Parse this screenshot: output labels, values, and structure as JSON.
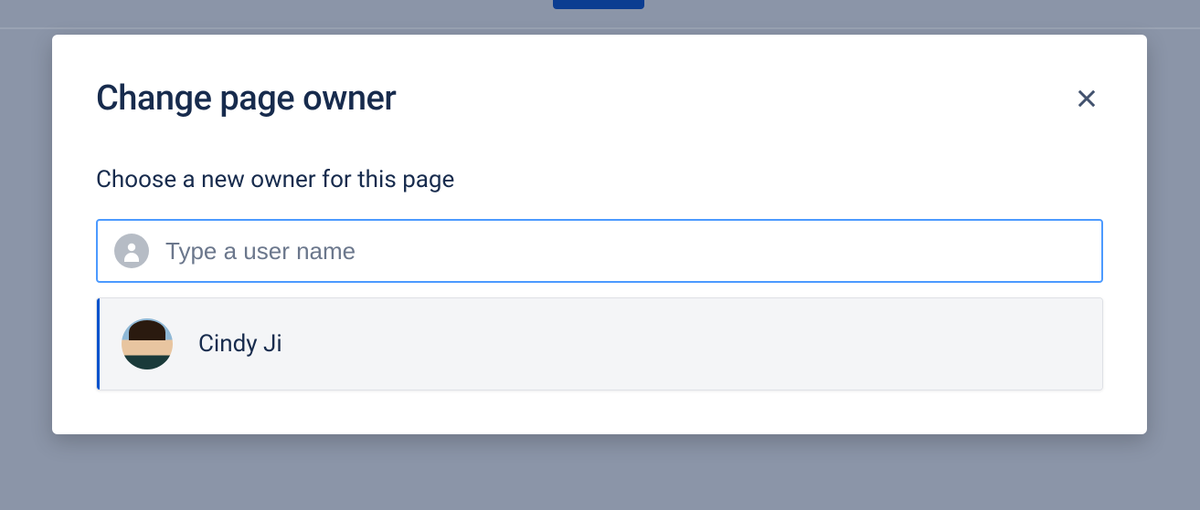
{
  "modal": {
    "title": "Change page owner",
    "subtitle": "Choose a new owner for this page"
  },
  "search": {
    "placeholder": "Type a user name",
    "value": ""
  },
  "results": [
    {
      "name": "Cindy Ji"
    }
  ]
}
